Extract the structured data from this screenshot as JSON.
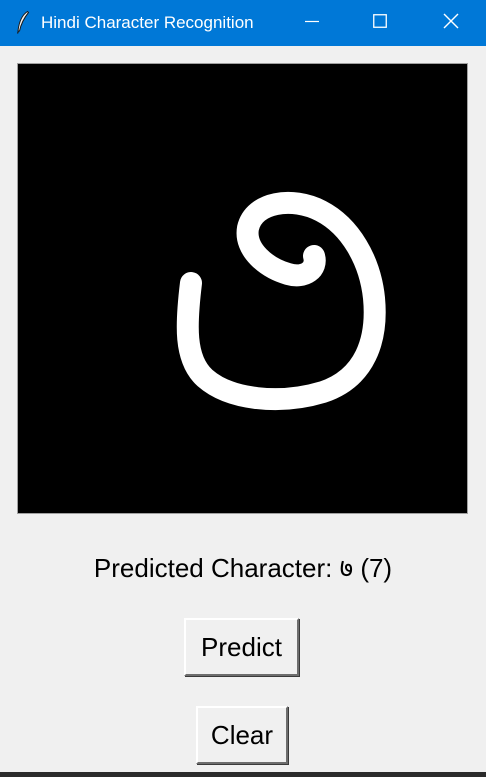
{
  "window": {
    "title": "Hindi Character Recognition",
    "icon": "feather-icon",
    "controls": [
      "minimize-icon",
      "maximize-icon",
      "close-icon"
    ],
    "titlebar_color": "#0078d7"
  },
  "canvas": {
    "background": "#000000",
    "stroke_color": "#ffffff",
    "content": "handwritten Devanagari digit"
  },
  "prediction": {
    "text": "Predicted Character: ७ (7)"
  },
  "buttons": {
    "predict_label": "Predict",
    "clear_label": "Clear"
  }
}
